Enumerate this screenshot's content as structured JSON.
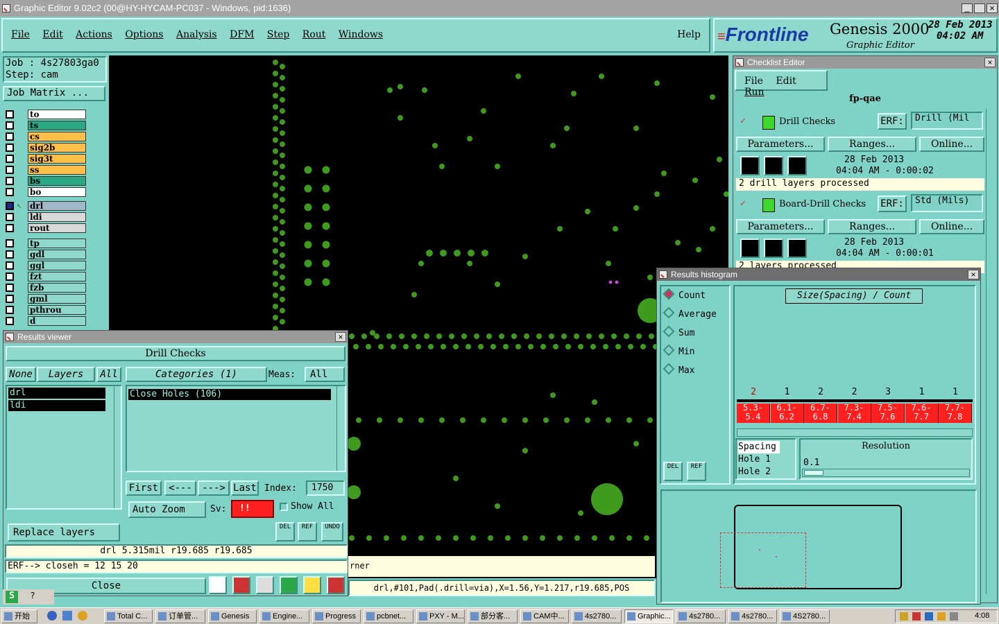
{
  "window": {
    "title": "Graphic Editor 9.02c2 (00@HY-HYCAM-PC037 - Windows, pid:1636)"
  },
  "menu": [
    "File",
    "Edit",
    "Actions",
    "Options",
    "Analysis",
    "DFM",
    "Step",
    "Rout",
    "Windows"
  ],
  "help": "Help",
  "brand": {
    "logo": "Frontline",
    "product": "Genesis 2000",
    "subtitle": "Graphic Editor",
    "date": "28 Feb 2013",
    "time": "04:02 AM"
  },
  "job": {
    "job": "Job : 4s27803ga0",
    "step": "Step: cam",
    "matrix": "Job Matrix ..."
  },
  "layers": [
    {
      "name": "to",
      "color": "#ffffff"
    },
    {
      "name": "ts",
      "color": "#2aa884"
    },
    {
      "name": "cs",
      "color": "#ffc04a"
    },
    {
      "name": "sig2b",
      "color": "#ffc04a"
    },
    {
      "name": "sig3t",
      "color": "#ffc04a"
    },
    {
      "name": "ss",
      "color": "#ffc04a"
    },
    {
      "name": "bs",
      "color": "#2aa884"
    },
    {
      "name": "bo",
      "color": "#ffffff"
    },
    {
      "name": "drl",
      "color": "#9fb8c8"
    },
    {
      "name": "ldi",
      "color": "#d8d8d8"
    },
    {
      "name": "rout",
      "color": "#d8d8d8"
    },
    {
      "name": "tp",
      "color": "#8fd9cc"
    },
    {
      "name": "gdl",
      "color": "#8fd9cc"
    },
    {
      "name": "ggl",
      "color": "#8fd9cc"
    },
    {
      "name": "fzt",
      "color": "#8fd9cc"
    },
    {
      "name": "fzb",
      "color": "#8fd9cc"
    },
    {
      "name": "gml",
      "color": "#8fd9cc"
    },
    {
      "name": "pthrou",
      "color": "#8fd9cc"
    },
    {
      "name": "d",
      "color": "#8fd9cc"
    }
  ],
  "results": {
    "title": "Results viewer",
    "header": "Drill Checks",
    "none": "None",
    "layers_label": "Layers",
    "all": "All",
    "categories": "Categories (1)",
    "meas_label": "Meas:",
    "meas_value": "All",
    "layer_list": [
      "drl",
      "ldi"
    ],
    "category_list": [
      "Close Holes (106)"
    ],
    "first": "First",
    "prev": "<---",
    "next": "--->",
    "last": "Last",
    "index_label": "Index:",
    "index_value": "1750",
    "auto_zoom": "Auto Zoom",
    "sv_label": "Sv:",
    "sv_value": "!!",
    "show_all": "Show All",
    "replace": "Replace layers",
    "del": "DEL",
    "ref": "REF",
    "undo": "UNDO",
    "status1": "drl  5.315mil   r19.685   r19.685",
    "status2": "ERF--> closeh = 12 15 20",
    "close": "Close"
  },
  "checklist": {
    "title": "Checklist Editor",
    "menu": [
      "File",
      "Edit",
      "Run"
    ],
    "name": "fp-qae",
    "items": [
      {
        "name": "Drill Checks",
        "erf_label": "ERF:",
        "erf": "Drill (Mil",
        "params": "Parameters...",
        "ranges": "Ranges...",
        "online": "Online...",
        "date": "28 Feb 2013",
        "time": "04:04 AM - 0:00:02",
        "status": "2 drill layers processed"
      },
      {
        "name": "Board-Drill Checks",
        "erf_label": "ERF:",
        "erf": "Std (Mils)",
        "params": "Parameters...",
        "ranges": "Ranges...",
        "online": "Online...",
        "date": "28 Feb 2013",
        "time": "04:04 AM - 0:00:01",
        "status": "2 layers processed"
      }
    ]
  },
  "histogram": {
    "title": "Results histogram",
    "options": [
      "Count",
      "Average",
      "Sum",
      "Min",
      "Max"
    ],
    "selected": "Count",
    "caption": "Size(Spacing) / Count",
    "counts": [
      "2",
      "1",
      "2",
      "2",
      "3",
      "1",
      "1"
    ],
    "bins": [
      "5.3-\n5.4",
      "6.1-\n6.2",
      "6.7-\n6.8",
      "7.3-\n7.4",
      "7.5-\n7.6",
      "7.6-\n7.7",
      "7.7-\n7.8"
    ],
    "spacing_list": [
      "Spacing",
      "Hole 1",
      "Hole 2"
    ],
    "resolution_label": "Resolution",
    "resolution_value": "0.1",
    "del": "DEL",
    "ref": "REF"
  },
  "statusbar": {
    "corner": "rner",
    "info": "drl,#101,Pad(.drill=via),X=1.56,Y=1.217,r19.685,POS"
  },
  "taskbar": {
    "start": "开始",
    "tasks": [
      "Total C...",
      "订单管...",
      "Genesis",
      "Engine...",
      "Progress",
      "pcbnet...",
      "PXY - M...",
      "部分客...",
      "CAM中...",
      "4s2780...",
      "Graphic...",
      "4s2780...",
      "4s2780...",
      "4S2780..."
    ],
    "clock": "4:08"
  }
}
